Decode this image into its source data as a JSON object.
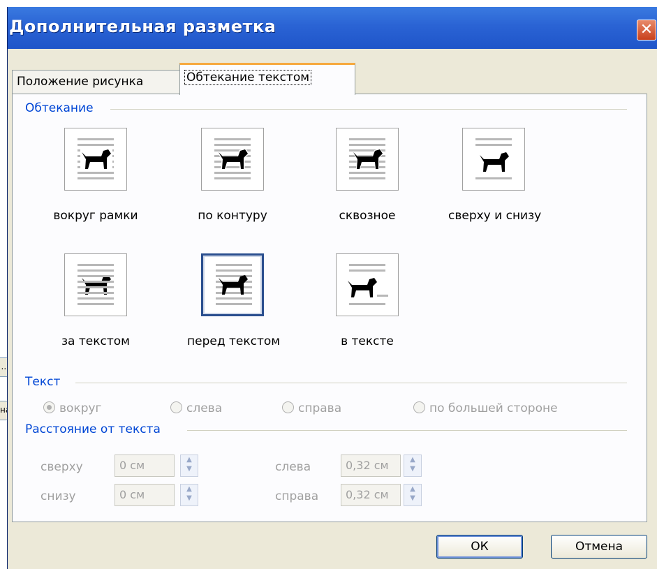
{
  "background": {
    "button1_fragment": "...",
    "button2_fragment": "на"
  },
  "dialog": {
    "title": "Дополнительная разметка",
    "close_glyph": "✕"
  },
  "tabs": [
    {
      "label": "Положение рисунка",
      "active": false
    },
    {
      "label": "Обтекание текстом",
      "active": true
    }
  ],
  "wrapping": {
    "group_label": "Обтекание",
    "options": [
      {
        "label": "вокруг рамки",
        "selected": false,
        "icon": "wrap-square-icon"
      },
      {
        "label": "по контуру",
        "selected": false,
        "icon": "wrap-tight-icon"
      },
      {
        "label": "сквозное",
        "selected": false,
        "icon": "wrap-through-icon"
      },
      {
        "label": "сверху и снизу",
        "selected": false,
        "icon": "wrap-top-bottom-icon"
      },
      {
        "label": "за текстом",
        "selected": false,
        "icon": "wrap-behind-text-icon"
      },
      {
        "label": "перед текстом",
        "selected": true,
        "icon": "wrap-in-front-of-text-icon"
      },
      {
        "label": "в тексте",
        "selected": false,
        "icon": "wrap-inline-icon"
      }
    ]
  },
  "text_side": {
    "group_label": "Текст",
    "options": [
      {
        "label": "вокруг",
        "checked": true
      },
      {
        "label": "слева",
        "checked": false
      },
      {
        "label": "справа",
        "checked": false
      },
      {
        "label": "по большей стороне",
        "checked": false
      }
    ]
  },
  "distance": {
    "group_label": "Расстояние от текста",
    "top": {
      "label": "сверху",
      "value": "0 см"
    },
    "bottom": {
      "label": "снизу",
      "value": "0 см"
    },
    "left": {
      "label": "слева",
      "value": "0,32 см"
    },
    "right": {
      "label": "справа",
      "value": "0,32 см"
    }
  },
  "buttons": {
    "ok": "ОК",
    "cancel": "Отмена"
  }
}
